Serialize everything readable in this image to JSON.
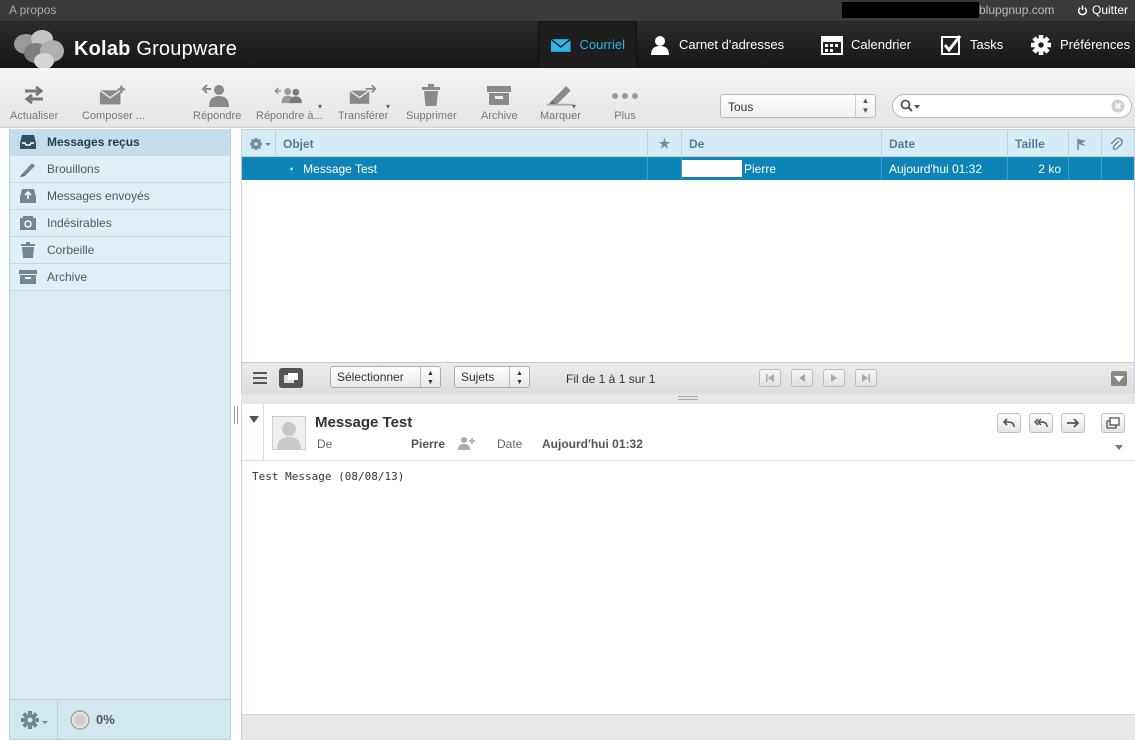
{
  "topbar": {
    "about": "A propos",
    "domain": "blupgnup.com",
    "quit": "Quitter"
  },
  "header": {
    "logo_bold": "Kolab",
    "logo_rest": " Groupware",
    "nav": [
      {
        "label": "Courriel",
        "icon": "envelope-icon",
        "active": true
      },
      {
        "label": "Carnet d'adresses",
        "icon": "person-icon"
      },
      {
        "label": "Calendrier",
        "icon": "calendar-icon"
      },
      {
        "label": "Tasks",
        "icon": "checkbox-icon"
      },
      {
        "label": "Préférences",
        "icon": "gear-icon"
      }
    ],
    "accent": "#2fb3e8"
  },
  "toolbar": {
    "refresh": "Actualiser",
    "compose": "Composer ...",
    "reply": "Répondre",
    "reply_all": "Répondre à...",
    "forward": "Transférer",
    "delete": "Supprimer",
    "archive": "Archive",
    "mark": "Marquer",
    "more": "Plus",
    "filter_value": "Tous",
    "search_value": ""
  },
  "folders": [
    {
      "label": "Messages reçus",
      "icon": "inbox-icon",
      "active": true
    },
    {
      "label": "Brouillons",
      "icon": "pencil-icon"
    },
    {
      "label": "Messages envoyés",
      "icon": "sent-icon"
    },
    {
      "label": "Indésirables",
      "icon": "junk-icon"
    },
    {
      "label": "Corbeille",
      "icon": "trash-icon"
    },
    {
      "label": "Archive",
      "icon": "archive-icon"
    }
  ],
  "quota": "0%",
  "list": {
    "columns": {
      "subject": "Objet",
      "from": "De",
      "date": "Date",
      "size": "Taille"
    },
    "rows": [
      {
        "subject": "Message Test",
        "from": "Pierre",
        "date": "Aujourd'hui 01:32",
        "size": "2 ko"
      }
    ],
    "select_label": "Sélectionner",
    "threads_label": "Sujets",
    "count_text": "Fil de 1 à 1 sur 1",
    "selected_color": "#0e83b7"
  },
  "preview": {
    "subject": "Message Test",
    "from_label": "De",
    "from_name": "Pierre",
    "date_label": "Date",
    "date_value": "Aujourd'hui 01:32",
    "body": "Test Message (08/08/13)"
  }
}
